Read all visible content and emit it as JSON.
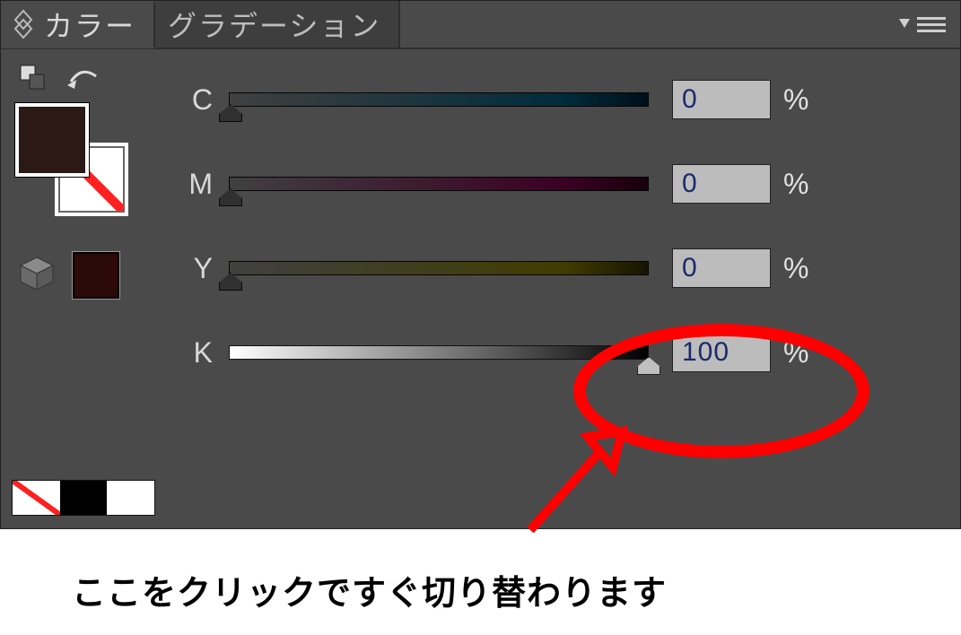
{
  "tabs": {
    "color": "カラー",
    "gradient": "グラデーション"
  },
  "channels": {
    "c": {
      "label": "C",
      "value": "0",
      "pos": 0
    },
    "m": {
      "label": "M",
      "value": "0",
      "pos": 0
    },
    "y": {
      "label": "Y",
      "value": "0",
      "pos": 0
    },
    "k": {
      "label": "K",
      "value": "100",
      "pos": 100
    }
  },
  "unit": "%",
  "caption": "ここをクリックですぐ切り替わります"
}
